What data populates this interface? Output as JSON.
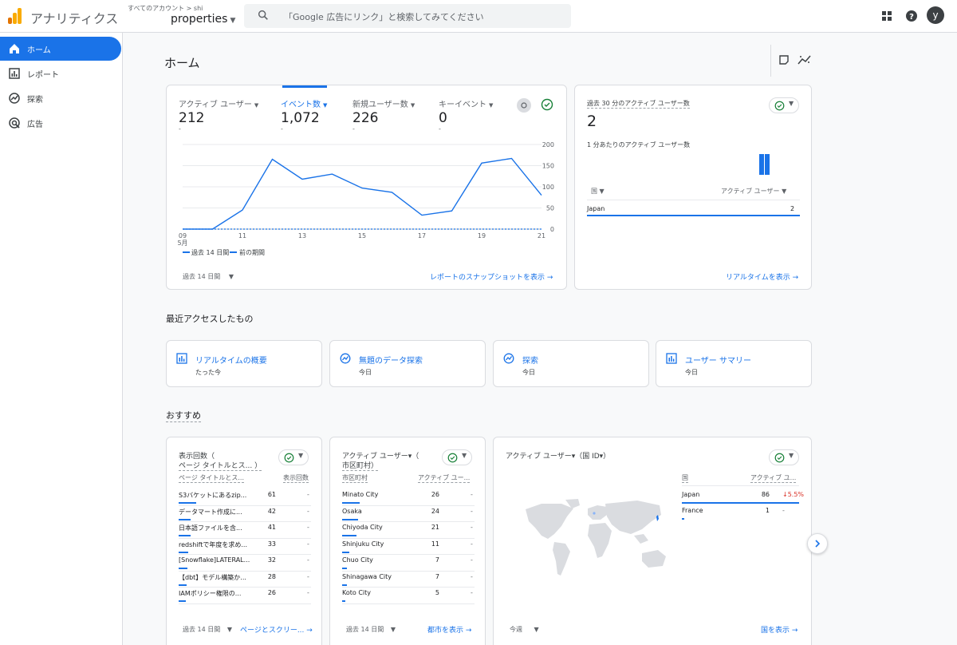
{
  "header": {
    "app_title": "アナリティクス",
    "account_breadcrumb": "すべてのアカウント > shi",
    "property_selector": "properties",
    "search_placeholder": "「Google 広告にリンク」と検索してみてください",
    "avatar_initial": "y",
    "icons": [
      "apps-grid-icon",
      "help-icon"
    ]
  },
  "sidebar": {
    "items": [
      {
        "label": "ホーム",
        "icon": "home-icon",
        "active": true
      },
      {
        "label": "レポート",
        "icon": "bar-chart-icon",
        "active": false
      },
      {
        "label": "探索",
        "icon": "explore-icon",
        "active": false
      },
      {
        "label": "広告",
        "icon": "ads-icon",
        "active": false
      }
    ]
  },
  "main": {
    "title": "ホーム",
    "overview": {
      "metrics": [
        {
          "label": "アクティブ ユーザー",
          "value": "212",
          "dot": "-"
        },
        {
          "label": "イベント数",
          "value": "1,072",
          "dot": "-",
          "selected": true
        },
        {
          "label": "新規ユーザー数",
          "value": "226",
          "dot": "-"
        },
        {
          "label": "キーイベント",
          "value": "0",
          "dot": "-"
        }
      ],
      "legend_current": "過去 14 日間",
      "legend_previous": "前の期間",
      "date_range": "過去 14 日間",
      "snapshot_link": "レポートのスナップショットを表示"
    },
    "realtime": {
      "label": "過去 30 分のアクティブ ユーザー数",
      "value": "2",
      "per_minute_label": "1 分あたりのアクティブ ユーザー数",
      "bar_values": [
        1,
        1
      ],
      "col_country": "国",
      "col_users": "アクティブ ユーザー",
      "rows": [
        {
          "country": "Japan",
          "users": "2"
        }
      ],
      "link": "リアルタイムを表示"
    },
    "recent": {
      "title": "最近アクセスしたもの",
      "items": [
        {
          "title": "リアルタイムの概要",
          "sub": "たった今",
          "icon": "report-icon"
        },
        {
          "title": "無題のデータ探索",
          "sub": "今日",
          "icon": "explore-icon"
        },
        {
          "title": "探索",
          "sub": "今日",
          "icon": "explore-icon"
        },
        {
          "title": "ユーザー サマリー",
          "sub": "今日",
          "icon": "report-icon"
        }
      ]
    },
    "recommended": {
      "title": "おすすめ",
      "pageviews": {
        "title_line1": "表示回数（",
        "title_line2": "ページ タイトルとス... ）",
        "col1": "ページ タイトルとス...",
        "col2": "表示回数",
        "rows": [
          {
            "label": "S3バケットにあるzip...",
            "value": "61",
            "dash": "-",
            "share": 1.0
          },
          {
            "label": "データマート作成に...",
            "value": "42",
            "dash": "-",
            "share": 0.69
          },
          {
            "label": "日本語ファイルを含...",
            "value": "41",
            "dash": "-",
            "share": 0.67
          },
          {
            "label": "redshiftで年度を求め...",
            "value": "33",
            "dash": "-",
            "share": 0.54
          },
          {
            "label": "[Snowflake]LATERAL...",
            "value": "32",
            "dash": "-",
            "share": 0.52
          },
          {
            "label": "【dbt】モデル構築か...",
            "value": "28",
            "dash": "-",
            "share": 0.46
          },
          {
            "label": "IAMポリシー権限の...",
            "value": "26",
            "dash": "-",
            "share": 0.43
          }
        ],
        "date_range": "過去 14 日間",
        "link": "ページとスクリー..."
      },
      "city": {
        "title_line1": "アクティブ ユーザー▾（",
        "title_line2": "市区町村）",
        "col1": "市区町村",
        "col2": "アクティブ ユー...",
        "rows": [
          {
            "label": "Minato City",
            "value": "26",
            "dash": "-",
            "share": 1.0
          },
          {
            "label": "Osaka",
            "value": "24",
            "dash": "-",
            "share": 0.92
          },
          {
            "label": "Chiyoda City",
            "value": "21",
            "dash": "-",
            "share": 0.81
          },
          {
            "label": "Shinjuku City",
            "value": "11",
            "dash": "-",
            "share": 0.42
          },
          {
            "label": "Chuo City",
            "value": "7",
            "dash": "-",
            "share": 0.27
          },
          {
            "label": "Shinagawa City",
            "value": "7",
            "dash": "-",
            "share": 0.27
          },
          {
            "label": "Koto City",
            "value": "5",
            "dash": "-",
            "share": 0.19
          }
        ],
        "date_range": "過去 14 日間",
        "link": "都市を表示"
      },
      "country": {
        "title": "アクティブ ユーザー▾（国 ID▾）",
        "col1": "国",
        "col2": "アクティブ ユ...",
        "rows": [
          {
            "label": "Japan",
            "value": "86",
            "change": "↓5.5%",
            "share": 1.0
          },
          {
            "label": "France",
            "value": "1",
            "change": "-",
            "share": 0.02
          }
        ],
        "date_range": "今週",
        "link": "国を表示"
      }
    }
  },
  "chart_data": {
    "type": "line",
    "x": [
      "09",
      "10",
      "11",
      "12",
      "13",
      "14",
      "15",
      "16",
      "17",
      "18",
      "19",
      "20",
      "21"
    ],
    "x_tick_labels": [
      "09",
      "11",
      "13",
      "15",
      "17",
      "19",
      "21"
    ],
    "x_sublabel": "5月",
    "series": [
      {
        "name": "過去 14 日間",
        "values": [
          0,
          0,
          45,
          165,
          118,
          130,
          97,
          87,
          33,
          43,
          156,
          167,
          80
        ],
        "color": "#1a73e8"
      },
      {
        "name": "前の期間",
        "values": [
          0,
          0,
          0,
          0,
          0,
          0,
          0,
          0,
          0,
          0,
          0,
          0,
          0
        ],
        "color": "#1a73e8",
        "dashed": true
      }
    ],
    "y_ticks": [
      "0",
      "50",
      "100",
      "150",
      "200"
    ],
    "ylim": [
      0,
      200
    ],
    "grid": true
  }
}
